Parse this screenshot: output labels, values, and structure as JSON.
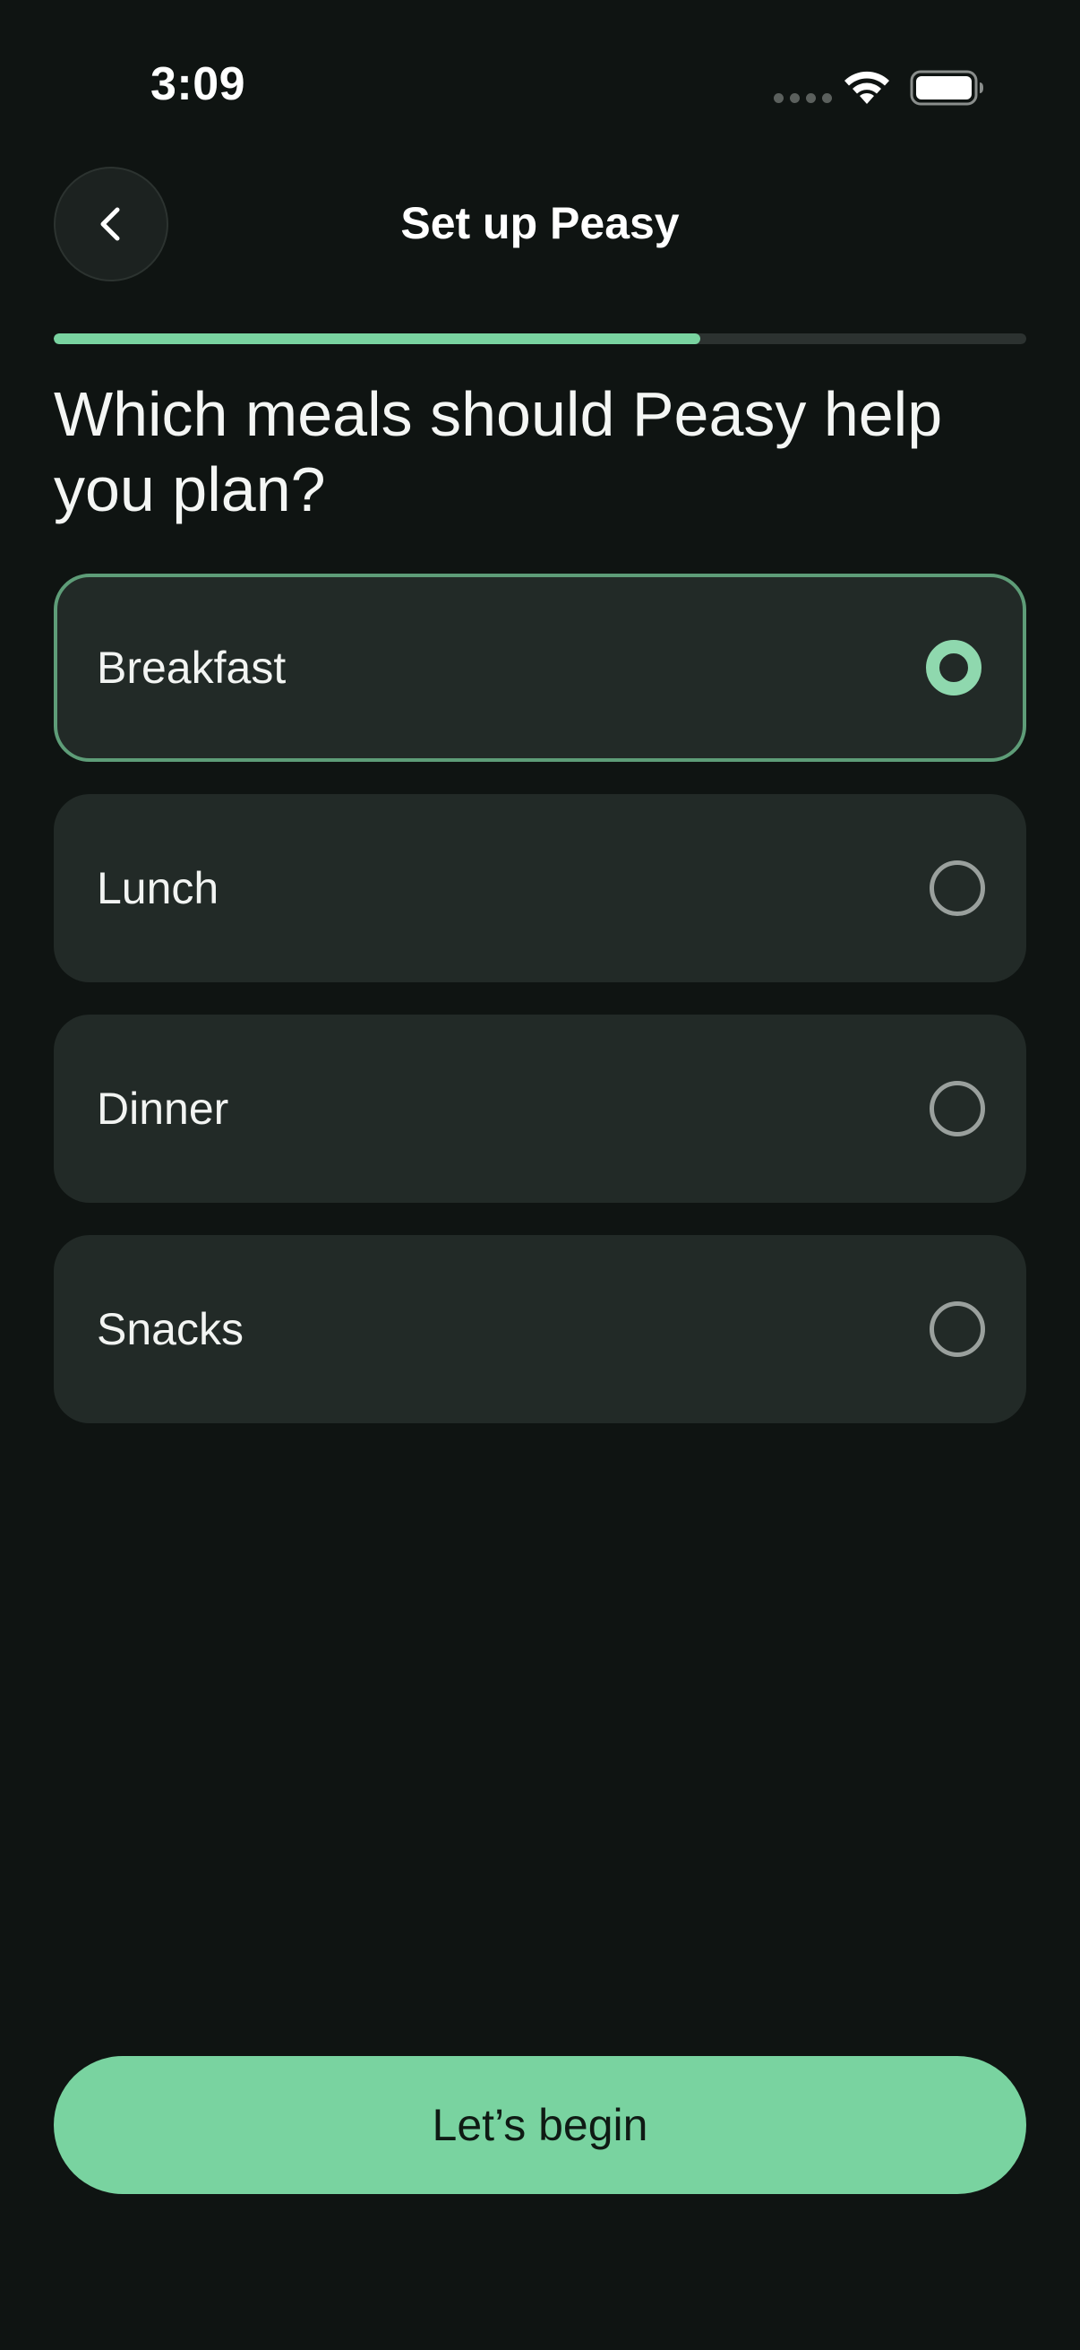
{
  "status_bar": {
    "time": "3:09"
  },
  "header": {
    "title": "Set up Peasy",
    "back_icon": "chevron-left-icon"
  },
  "progress": {
    "fraction": 0.665
  },
  "question": "Which meals should Peasy help you plan?",
  "options": [
    {
      "label": "Breakfast",
      "selected": true
    },
    {
      "label": "Lunch",
      "selected": false
    },
    {
      "label": "Dinner",
      "selected": false
    },
    {
      "label": "Snacks",
      "selected": false
    }
  ],
  "cta": {
    "label": "Let’s begin"
  },
  "colors": {
    "background": "#0f1412",
    "accent": "#79d3a0",
    "card": "#222a27",
    "selected_border": "#5e9d78"
  }
}
